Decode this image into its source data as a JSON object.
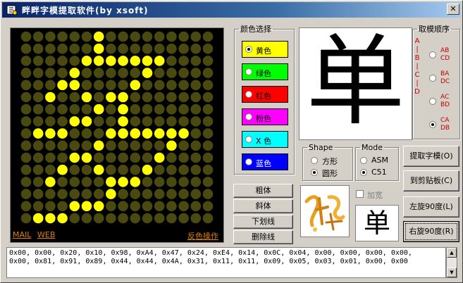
{
  "window": {
    "title": "畔畔字模提取软件(by xsoft)"
  },
  "display": {
    "cols": 16,
    "rows": 16,
    "dot_on": "#ffff00",
    "dot_off": "#4a4a10",
    "bytes_hex": [
      "0x00",
      "0x00",
      "0x20",
      "0x10",
      "0x98",
      "0xA4",
      "0x47",
      "0x24",
      "0xE4",
      "0x14",
      "0x0C",
      "0x04",
      "0x00",
      "0x00",
      "0x00",
      "0x00",
      "0x00",
      "0x81",
      "0x91",
      "0x89",
      "0x44",
      "0x44",
      "0x4A",
      "0x31",
      "0x11",
      "0x11",
      "0x09",
      "0x05",
      "0x03",
      "0x01",
      "0x00",
      "0x00"
    ],
    "links": {
      "mail": "MAIL",
      "web": "WEB",
      "invert": "反色操作"
    }
  },
  "color_group": {
    "legend": "颜色选择",
    "options": [
      {
        "label": "黄色",
        "color": "#ffff00",
        "selected": true
      },
      {
        "label": "绿色",
        "color": "#00ff00",
        "selected": false
      },
      {
        "label": "红色",
        "color": "#ff0000",
        "selected": false
      },
      {
        "label": "粉色",
        "color": "#ff00ff",
        "selected": false
      },
      {
        "label": "X 色",
        "color": "#00ffff",
        "selected": false
      },
      {
        "label": "蓝色",
        "color": "#0000ff",
        "selected": false
      }
    ]
  },
  "preview": {
    "char": "单"
  },
  "order_group": {
    "legend": "取模顺序",
    "side_label": "A|B|C|D",
    "options": [
      {
        "line1": "AB",
        "line2": "CD",
        "selected": false
      },
      {
        "line1": "BA",
        "line2": "DC",
        "selected": false
      },
      {
        "line1": "AC",
        "line2": "BD",
        "selected": false
      },
      {
        "line1": "CA",
        "line2": "DB",
        "selected": true
      }
    ]
  },
  "shape_group": {
    "legend": "Shape",
    "options": [
      {
        "label": "方形",
        "selected": false
      },
      {
        "label": "圆形",
        "selected": true
      }
    ]
  },
  "mode_group": {
    "legend": "Mode",
    "options": [
      {
        "label": "ASM",
        "selected": false
      },
      {
        "label": "C51",
        "selected": true
      }
    ]
  },
  "style_buttons": {
    "bold": "粗体",
    "italic": "斜体",
    "underline": "下划线",
    "strike": "删除线"
  },
  "widen": {
    "label": "加宽"
  },
  "small_preview": {
    "char": "单"
  },
  "actions": {
    "extract": "提取字模(O)",
    "clipboard": "到剪贴板(C)",
    "rotate_left": "左旋90度(L)",
    "rotate_right": "右旋90度(R)"
  },
  "output": {
    "line1": "0x00, 0x00, 0x20, 0x10, 0x98, 0xA4, 0x47, 0x24, 0xE4, 0x14, 0x0C, 0x04, 0x00, 0x00, 0x00, 0x00,",
    "line2": "0x00, 0x81, 0x91, 0x89, 0x44, 0x44, 0x4A, 0x31, 0x11, 0x11, 0x09, 0x05, 0x03, 0x01, 0x00, 0x00"
  }
}
